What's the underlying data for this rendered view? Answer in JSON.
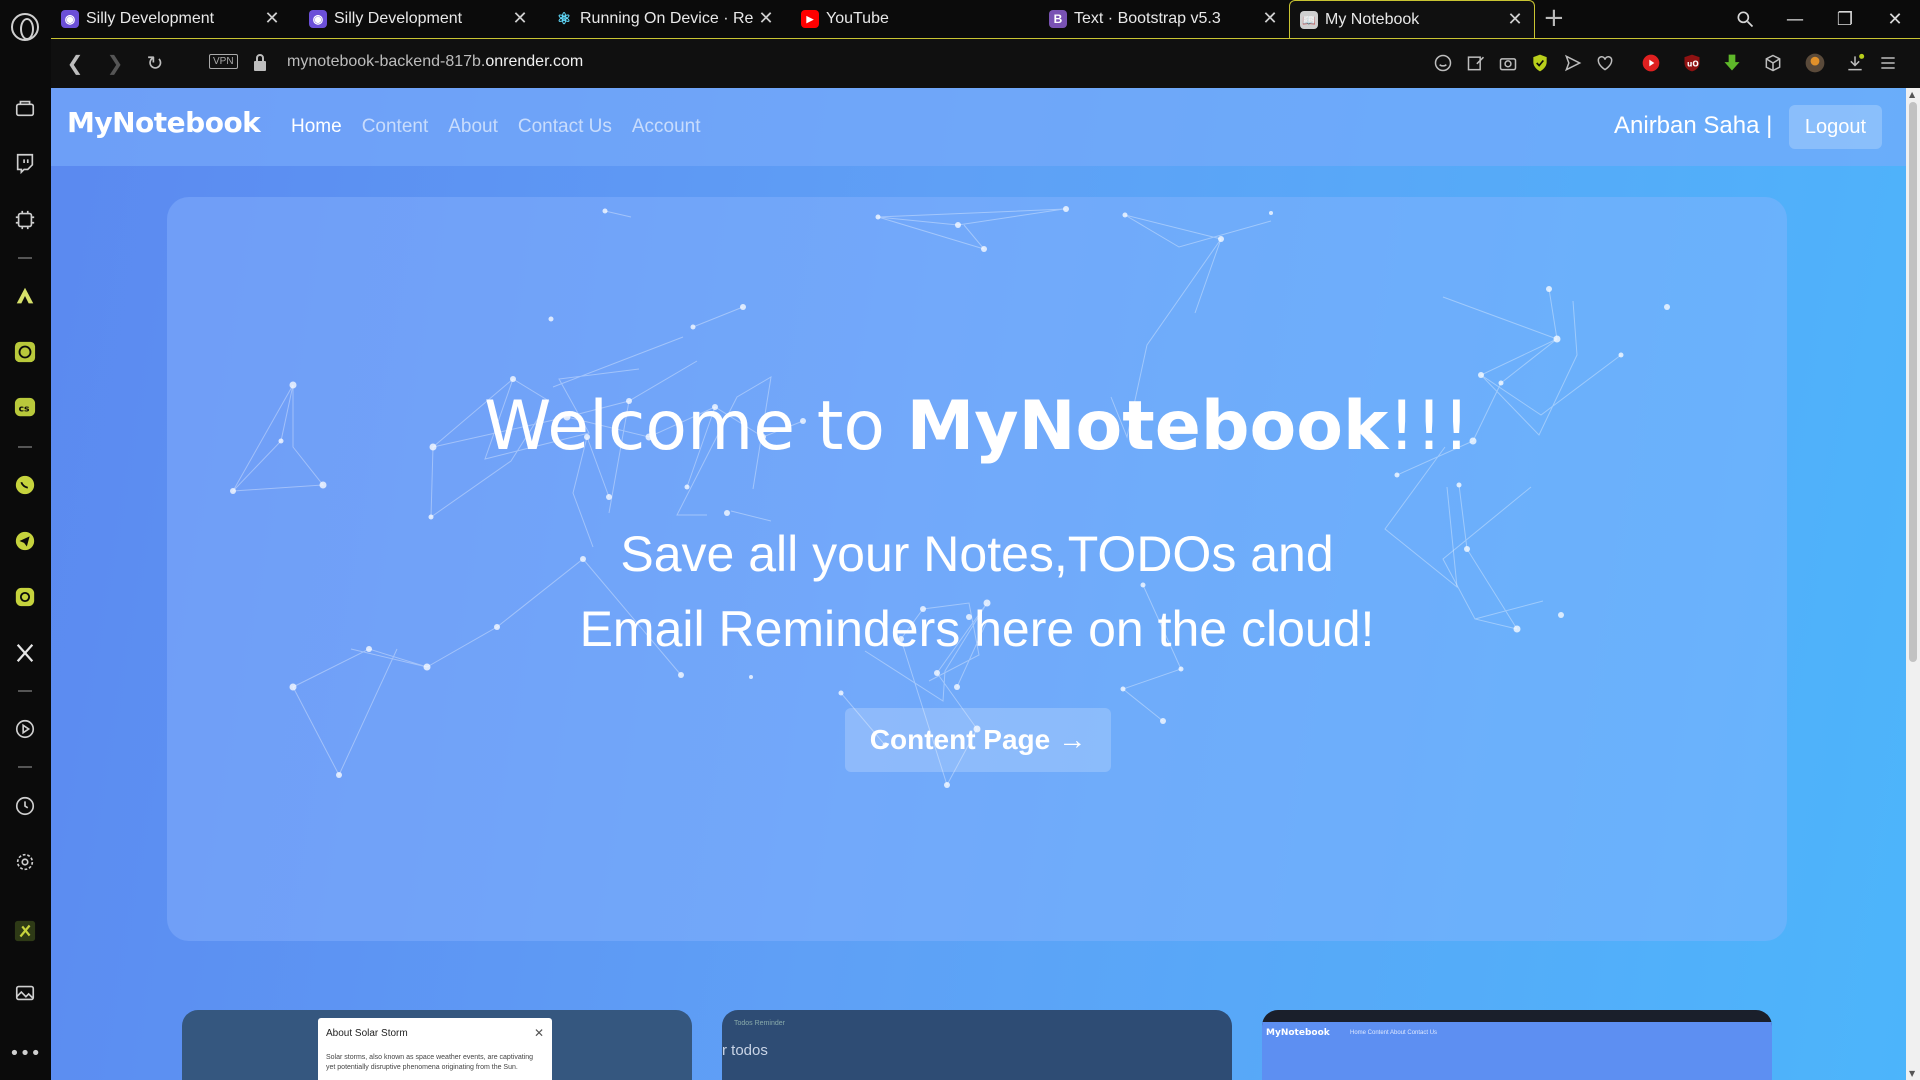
{
  "browser": {
    "tabs": [
      {
        "title": "Silly Development",
        "favicon": "silly-dev-icon",
        "color": "#6b4fd8"
      },
      {
        "title": "Silly Development",
        "favicon": "silly-dev-icon",
        "color": "#6b4fd8"
      },
      {
        "title": "Running On Device · React",
        "favicon": "react-icon",
        "color": "#61dafb"
      },
      {
        "title": "YouTube",
        "favicon": "youtube-icon",
        "color": "#ff0000"
      },
      {
        "title": "Text · Bootstrap v5.3",
        "favicon": "bootstrap-icon",
        "color": "#7952b3",
        "glyph": "B"
      },
      {
        "title": "My Notebook",
        "favicon": "notebook-icon",
        "color": "#b0b0b0",
        "active": true
      }
    ],
    "address": {
      "vpn_label": "VPN",
      "url_prefix": "mynotebook-backend-817b.",
      "url_domain": "onrender.com"
    }
  },
  "page": {
    "brand": "MyNotebook",
    "nav": [
      {
        "label": "Home",
        "active": true
      },
      {
        "label": "Content"
      },
      {
        "label": "About"
      },
      {
        "label": "Contact Us"
      },
      {
        "label": "Account"
      }
    ],
    "user": "Anirban Saha |",
    "logout_label": "Logout",
    "hero": {
      "title_pre": "Welcome to ",
      "title_brand": "MyNotebook",
      "title_post": "!!!",
      "subtitle_line1": "Save all your Notes,TODOs and",
      "subtitle_line2": "Email Reminders here on the cloud!",
      "cta_label": "Content Page",
      "cta_arrow": "→"
    },
    "previews": {
      "card1_popup_title": "About Solar Storm",
      "card1_popup_close": "✕",
      "card1_popup_body": "Solar storms, also known as space weather events, are captivating yet potentially disruptive phenomena originating from the Sun.",
      "card2_tabs": "Todos    Reminder",
      "card2_heading": "r todos",
      "card3_brand": "MyNotebook",
      "card3_links": "Home   Content   About   Contact Us"
    }
  }
}
